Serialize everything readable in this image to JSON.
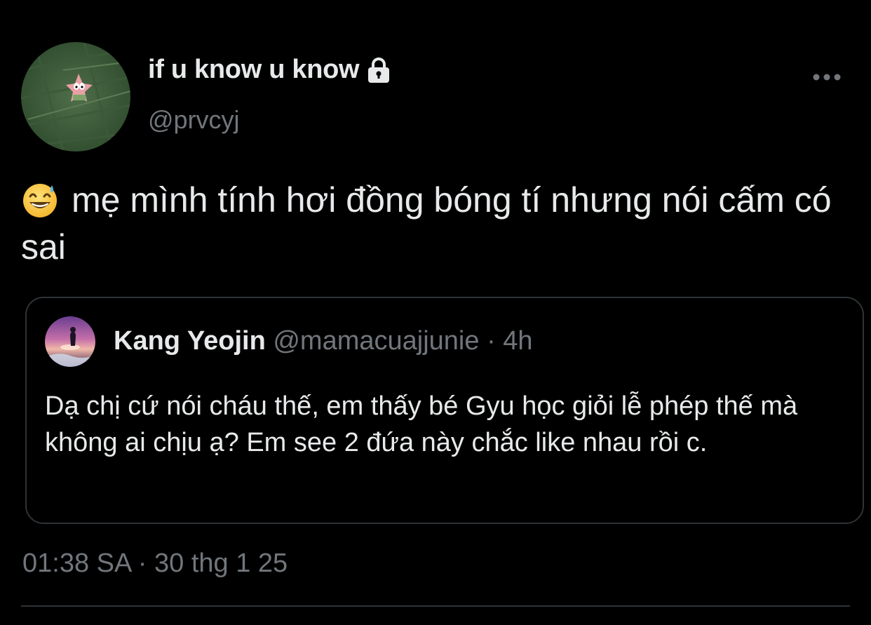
{
  "author": {
    "display_name": "if u know u know",
    "handle": "@prvcyj",
    "protected_icon": "lock-icon",
    "avatar_icon": "patrick-star-avatar"
  },
  "more_icon": "more-horizontal-icon",
  "tweet": {
    "emoji": "grinning-face-with-sweat-emoji",
    "text": "mẹ mình tính hơi đồng bóng tí nhưng nói cấm có sai"
  },
  "quoted_tweet": {
    "display_name": "Kang Yeojin",
    "handle": "@mamacuajjunie",
    "separator": "·",
    "time": "4h",
    "text": "Dạ chị cứ nói cháu thế, em thấy bé Gyu học giỏi lễ phép thế mà không ai chịu ạ? Em see 2 đứa này chắc like nhau rồi c."
  },
  "timestamp": "01:38 SA · 30 thg 1 25",
  "colors": {
    "background": "#000000",
    "primary_text": "#e7e9ea",
    "secondary_text": "#71767b",
    "border": "#2f3336"
  }
}
